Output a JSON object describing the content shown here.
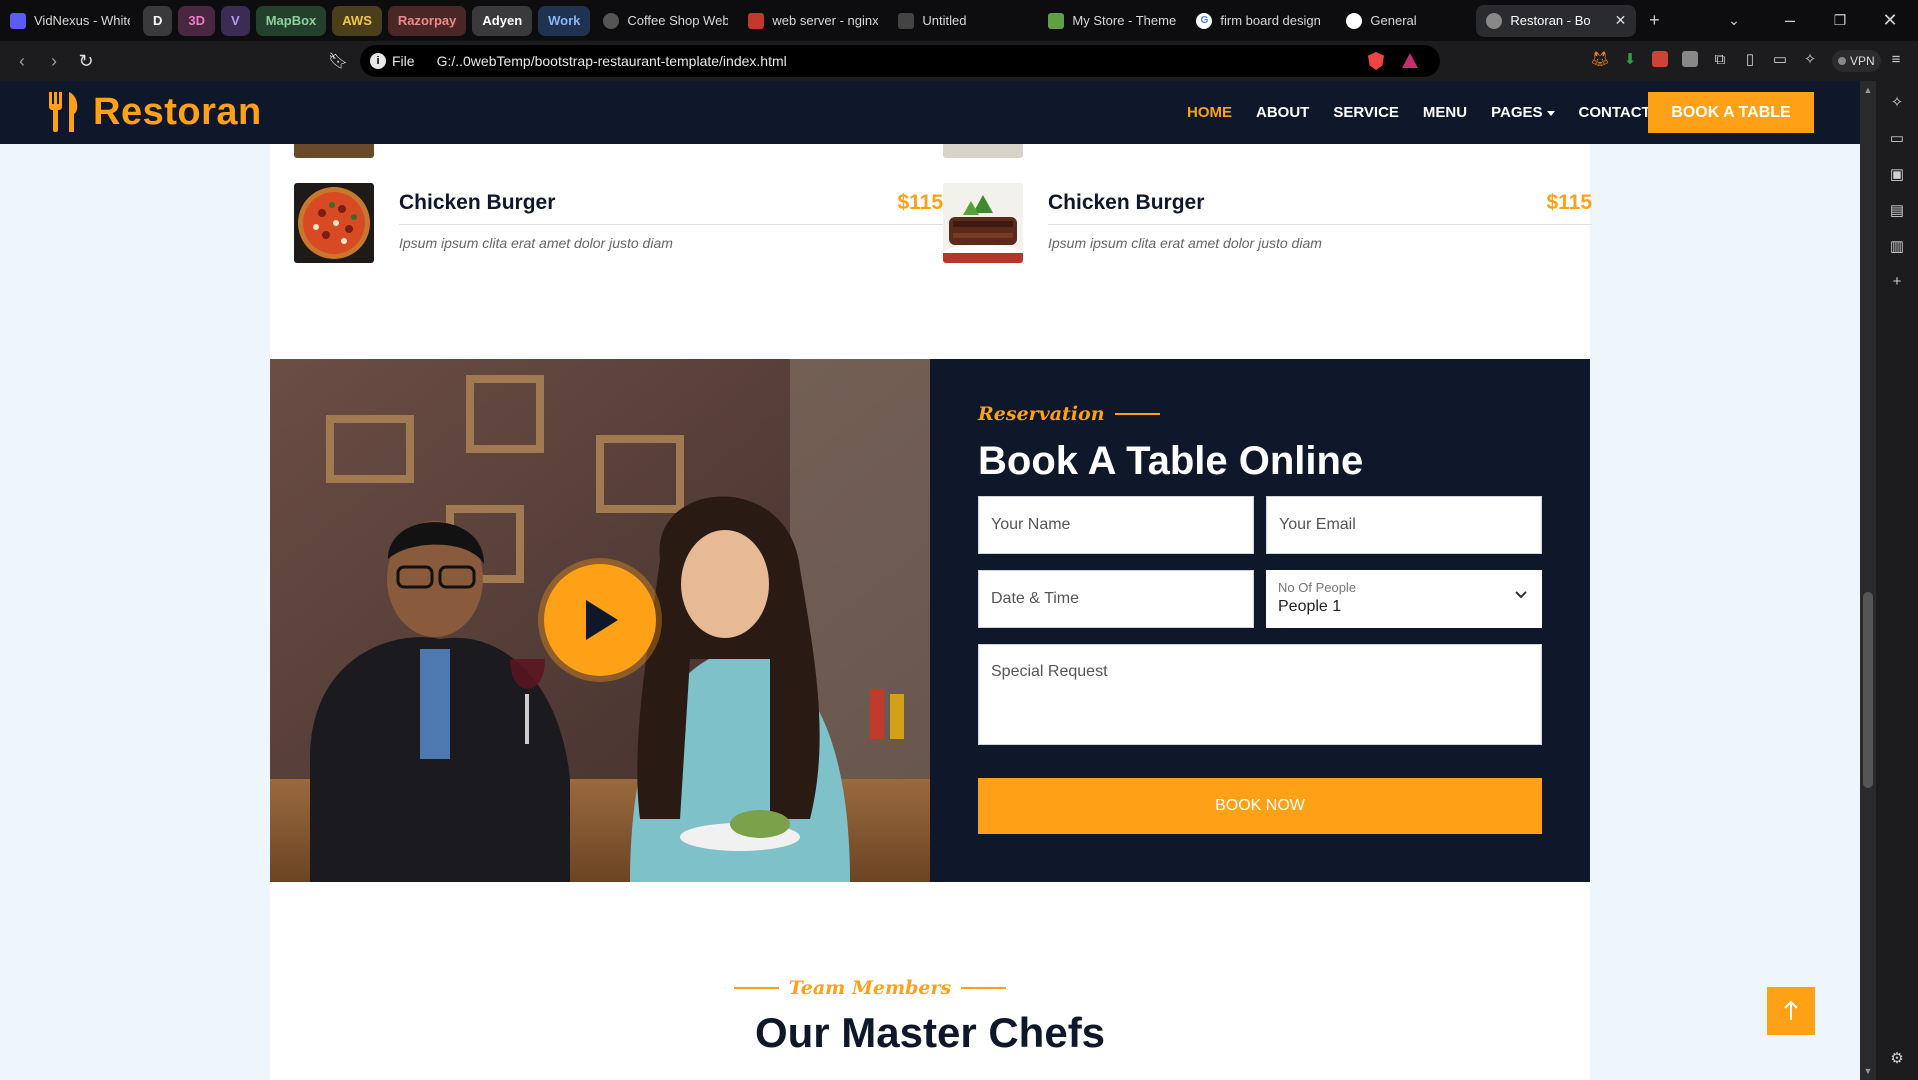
{
  "browser": {
    "tabs": [
      {
        "title": "VidNexus - Whitel",
        "fav_color": "#5b5bf5"
      },
      {
        "title": "Coffee Shop Web",
        "fav_color": "#777777"
      },
      {
        "title": "web server - nginx",
        "fav_color": "#c0392b"
      },
      {
        "title": "Untitled",
        "fav_color": "#444444"
      },
      {
        "title": "My Store - Themes",
        "fav_color": "#5fa043"
      },
      {
        "title": "firm board design",
        "fav_color": "#4285f4"
      },
      {
        "title": "General",
        "fav_color": "#333333"
      }
    ],
    "groups": [
      {
        "label": "D",
        "bg": "#3a3a3d",
        "fg": "#ffffff"
      },
      {
        "label": "3D",
        "bg": "#4a2740",
        "fg": "#f07ac8"
      },
      {
        "label": "V",
        "bg": "#3a2c52",
        "fg": "#b69af0"
      },
      {
        "label": "MapBox",
        "bg": "#23402c",
        "fg": "#8fd19e"
      },
      {
        "label": "AWS",
        "bg": "#4a3f1a",
        "fg": "#f2c744"
      },
      {
        "label": "Razorpay",
        "bg": "#4a2626",
        "fg": "#f08a8a"
      },
      {
        "label": "Adyen",
        "bg": "#3a3a3d",
        "fg": "#ffffff"
      },
      {
        "label": "Work",
        "bg": "#1f3250",
        "fg": "#8ab4f8"
      }
    ],
    "active_tab": "Restoran - Bo",
    "new_tab": "+",
    "address_scheme": "File",
    "address_url": "G:/..0webTemp/bootstrap-restaurant-template/index.html",
    "vpn_label": "VPN"
  },
  "site": {
    "brand": "Restoran",
    "nav": [
      {
        "label": "HOME",
        "active": true
      },
      {
        "label": "ABOUT",
        "active": false
      },
      {
        "label": "SERVICE",
        "active": false
      },
      {
        "label": "MENU",
        "active": false
      },
      {
        "label": "PAGES",
        "active": false
      },
      {
        "label": "CONTACT",
        "active": false
      }
    ],
    "book_table": "BOOK A TABLE",
    "menu_items": [
      {
        "name": "Chicken Burger",
        "price": "$115",
        "desc": "Ipsum ipsum clita erat amet dolor justo diam"
      },
      {
        "name": "Chicken Burger",
        "price": "$115",
        "desc": "Ipsum ipsum clita erat amet dolor justo diam"
      }
    ],
    "reservation": {
      "subtitle": "Reservation",
      "title": "Book A Table Online",
      "name_placeholder": "Your Name",
      "email_placeholder": "Your Email",
      "datetime_placeholder": "Date & Time",
      "people_label": "No Of People",
      "people_value": "People 1",
      "request_placeholder": "Special Request",
      "submit": "BOOK NOW"
    },
    "team": {
      "subtitle": "Team Members",
      "title": "Our Master Chefs"
    }
  },
  "colors": {
    "primary": "#fea116",
    "dark": "#0f172b"
  }
}
